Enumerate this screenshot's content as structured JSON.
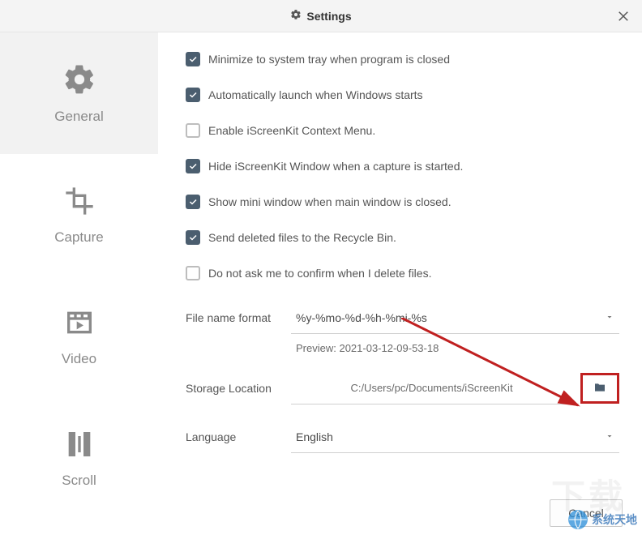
{
  "title": "Settings",
  "sidebar": {
    "items": [
      {
        "label": "General",
        "icon": "gear-icon"
      },
      {
        "label": "Capture",
        "icon": "crop-icon"
      },
      {
        "label": "Video",
        "icon": "video-icon"
      },
      {
        "label": "Scroll",
        "icon": "scroll-icon"
      }
    ]
  },
  "options": {
    "minimize_tray": {
      "label": "Minimize to system tray when program is closed",
      "checked": true
    },
    "auto_launch": {
      "label": "Automatically launch when Windows starts",
      "checked": true
    },
    "context_menu": {
      "label": "Enable iScreenKit Context Menu.",
      "checked": false
    },
    "hide_on_capture": {
      "label": "Hide iScreenKit Window when a capture is started.",
      "checked": true
    },
    "mini_window": {
      "label": "Show mini window when main window is closed.",
      "checked": true
    },
    "recycle_bin": {
      "label": "Send deleted files to the Recycle Bin.",
      "checked": true
    },
    "no_confirm_del": {
      "label": "Do not ask me to confirm when I delete files.",
      "checked": false
    }
  },
  "filename": {
    "label": "File name format",
    "value": "%y-%mo-%d-%h-%mi-%s",
    "preview_label": "Preview: 2021-03-12-09-53-18"
  },
  "storage": {
    "label": "Storage Location",
    "path": "C:/Users/pc/Documents/iScreenKit"
  },
  "language": {
    "label": "Language",
    "value": "English"
  },
  "buttons": {
    "cancel": "Cancel"
  },
  "watermark": "系统天地"
}
